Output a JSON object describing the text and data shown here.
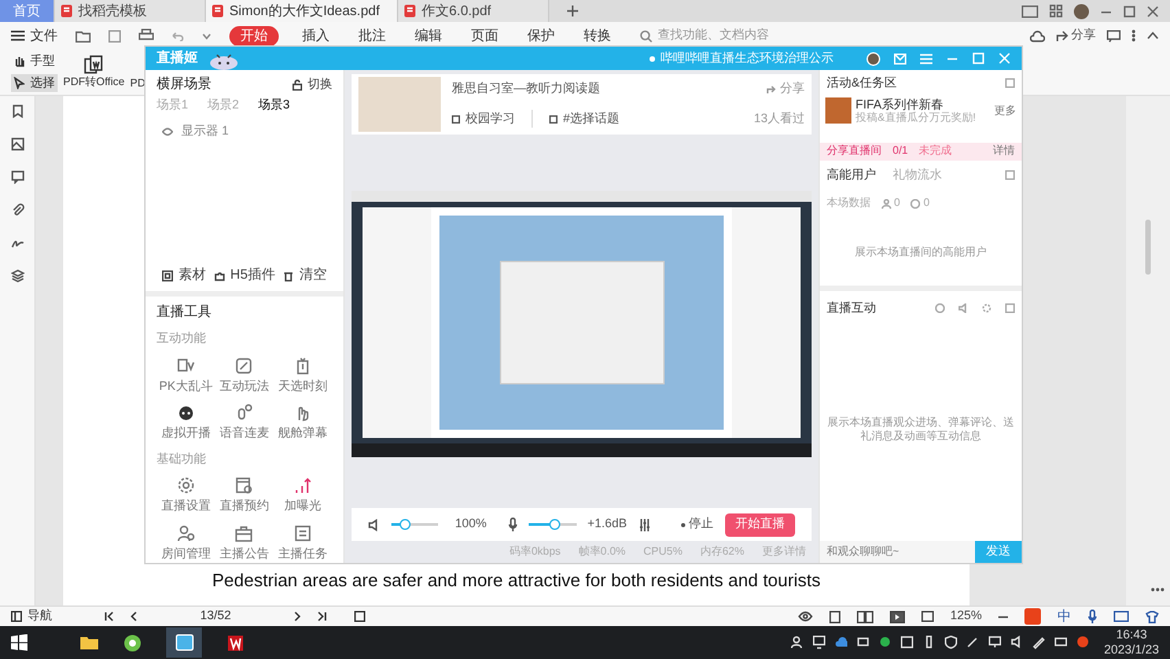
{
  "pdf_app": {
    "tabs": [
      {
        "label": "首页",
        "selected": false,
        "kind": "home"
      },
      {
        "label": "找稻壳模板",
        "selected": false,
        "kind": "doc"
      },
      {
        "label": "Simon的大作文Ideas.pdf",
        "selected": true,
        "kind": "doc"
      },
      {
        "label": "作文6.0.pdf",
        "selected": false,
        "kind": "doc"
      }
    ],
    "file_menu": "文件",
    "ribbon_tabs": [
      {
        "label": "开始",
        "selected": true
      },
      {
        "label": "插入",
        "selected": false
      },
      {
        "label": "批注",
        "selected": false
      },
      {
        "label": "编辑",
        "selected": false
      },
      {
        "label": "页面",
        "selected": false
      },
      {
        "label": "保护",
        "selected": false
      },
      {
        "label": "转换",
        "selected": false
      }
    ],
    "search": {
      "placeholder": "查找功能、文档内容"
    },
    "share": "分享",
    "tools": [
      {
        "label": "手型",
        "selected": false
      },
      {
        "label": "选择",
        "selected": true
      }
    ],
    "convert": "PDF转Office",
    "convert_cut": "PD",
    "document_text": "Pedestrian areas are safer and more attractive for both residents and tourists",
    "status_bar": {
      "nav": "导航",
      "page": "13/52",
      "zoom": "125%"
    }
  },
  "live_app": {
    "logo": "直播姬",
    "notice": "哔哩哔哩直播生态环境治理公示",
    "scene_panel": {
      "title": "横屏场景",
      "switch": "切换",
      "scenes": [
        {
          "label": "场景1",
          "selected": false
        },
        {
          "label": "场景2",
          "selected": false
        },
        {
          "label": "场景3",
          "selected": true
        }
      ],
      "sources": [
        "显示器 1"
      ],
      "actions": [
        "素材",
        "H5插件",
        "清空"
      ]
    },
    "tools": {
      "title": "直播工具",
      "groups": [
        {
          "title": "互动功能",
          "items": [
            "PK大乱斗",
            "互动玩法",
            "天选时刻",
            "虚拟开播",
            "语音连麦",
            "舰舱弹幕"
          ]
        },
        {
          "title": "基础功能",
          "items": [
            "直播设置",
            "直播预约",
            "加曝光",
            "房间管理",
            "主播公告",
            "主播任务"
          ]
        }
      ]
    },
    "room": {
      "title": "雅思自习室—教听力阅读题",
      "share": "分享",
      "category": "校园学习",
      "topic": "#选择话题",
      "viewers": "13人看过"
    },
    "controls": {
      "speaker": {
        "level": 0.3
      },
      "speaker_reading": "100%",
      "mic": {
        "level": 0.55
      },
      "mic_reading": "+1.6dB",
      "stop": "停止",
      "start": "开始直播"
    },
    "stats": [
      "码率0kbps",
      "帧率0.0%",
      "CPU5%",
      "内存62%",
      "更多详情"
    ],
    "activity": {
      "title": "活动&任务区",
      "promo_title": "FIFA系列伴新春",
      "promo_sub": "投稿&直播瓜分万元奖励!",
      "more": "更多",
      "task": "分享直播间",
      "progress": "0/1",
      "status": "未完成",
      "details": "详情"
    },
    "high_energy": {
      "tabs": [
        {
          "label": "高能用户",
          "selected": true
        },
        {
          "label": "礼物流水",
          "selected": false
        }
      ],
      "data_label": "本场数据",
      "counts": [
        "0",
        "0"
      ],
      "empty": "展示本场直播间的高能用户"
    },
    "interaction": {
      "title": "直播互动",
      "empty": "展示本场直播观众进场、弹幕评论、送礼消息及动画等互动信息",
      "placeholder": "和观众聊聊吧~",
      "send": "发送"
    }
  },
  "taskbar": {
    "ime": "中",
    "time": "16:43",
    "date": "2023/1/23"
  }
}
